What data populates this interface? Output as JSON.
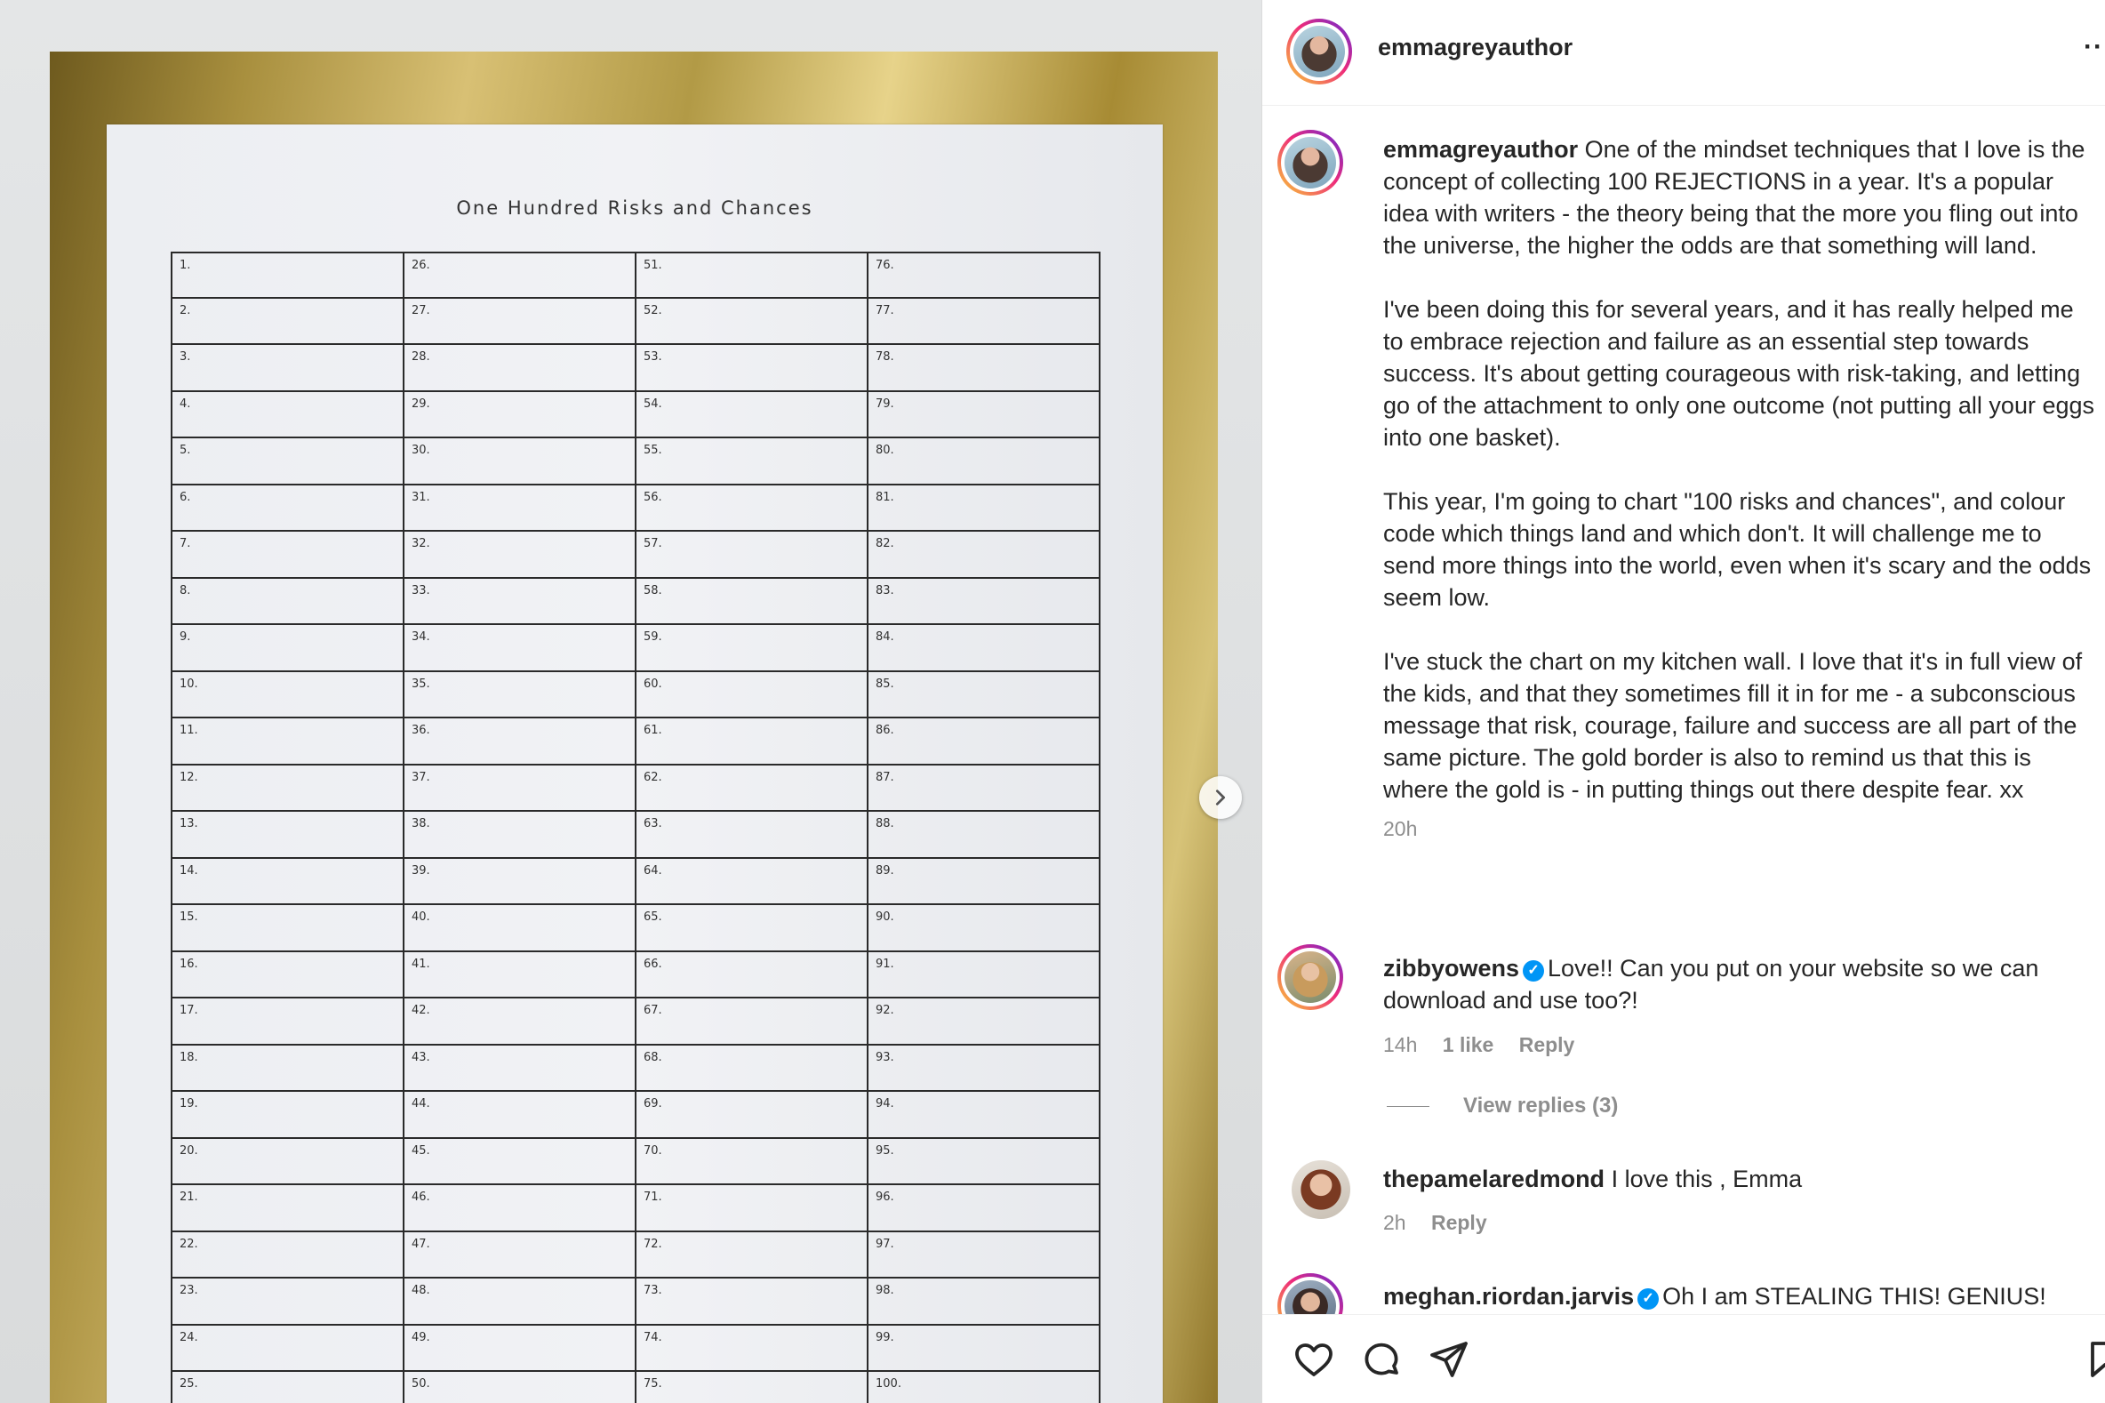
{
  "photo": {
    "chart_title": "One Hundred Risks and Chances",
    "columns": [
      [
        "1.",
        "2.",
        "3.",
        "4.",
        "5.",
        "6.",
        "7.",
        "8.",
        "9.",
        "10.",
        "11.",
        "12.",
        "13.",
        "14.",
        "15.",
        "16.",
        "17.",
        "18.",
        "19.",
        "20.",
        "21.",
        "22.",
        "23.",
        "24.",
        "25."
      ],
      [
        "26.",
        "27.",
        "28.",
        "29.",
        "30.",
        "31.",
        "32.",
        "33.",
        "34.",
        "35.",
        "36.",
        "37.",
        "38.",
        "39.",
        "40.",
        "41.",
        "42.",
        "43.",
        "44.",
        "45.",
        "46.",
        "47.",
        "48.",
        "49.",
        "50."
      ],
      [
        "51.",
        "52.",
        "53.",
        "54.",
        "55.",
        "56.",
        "57.",
        "58.",
        "59.",
        "60.",
        "61.",
        "62.",
        "63.",
        "64.",
        "65.",
        "66.",
        "67.",
        "68.",
        "69.",
        "70.",
        "71.",
        "72.",
        "73.",
        "74.",
        "75."
      ],
      [
        "76.",
        "77.",
        "78.",
        "79.",
        "80.",
        "81.",
        "82.",
        "83.",
        "84.",
        "85.",
        "86.",
        "87.",
        "88.",
        "89.",
        "90.",
        "91.",
        "92.",
        "93.",
        "94.",
        "95.",
        "96.",
        "97.",
        "98.",
        "99.",
        "100."
      ]
    ]
  },
  "post": {
    "author": "emmagreyauthor",
    "caption_paragraphs": [
      "One of the mindset techniques that I love is the concept of collecting 100 REJECTIONS in a year. It's a popular idea with writers - the theory being that the more you fling out into the universe, the higher the odds are that something will land.",
      "I've been doing this for several years, and it has really helped me to embrace rejection and failure as an essential step towards success. It's about getting courageous with risk-taking, and letting go of the attachment to only one outcome (not putting all your eggs into one basket).",
      "This year, I'm going to chart \"100 risks and chances\", and colour code which things land and which don't. It will challenge me to send more things into the world, even when it's scary and the odds seem low.",
      "I've stuck the chart on my kitchen wall. I love that it's in full view of the kids, and that they sometimes fill it in for me - a subconscious message that risk, courage, failure and success are all part of the same picture. The gold border is also to remind us that this is where the gold is - in putting things out there despite fear. xx"
    ],
    "caption_time": "20h"
  },
  "comments": [
    {
      "user": "zibbyowens",
      "verified": true,
      "text": "Love!! Can you put on your website so we can download and use too?!",
      "time": "14h",
      "likes": "1 like",
      "reply": "Reply",
      "view_replies": "View replies (3)"
    },
    {
      "user": "thepamelaredmond",
      "verified": false,
      "text": "I love this , Emma",
      "time": "2h",
      "reply": "Reply"
    },
    {
      "user": "meghan.riordan.jarvis",
      "verified": true,
      "text": "Oh I am STEALING THIS! GENIUS!"
    }
  ],
  "icons": {
    "verified": "check-badge",
    "like": "heart-icon",
    "comment": "comment-icon",
    "share": "send-icon",
    "save": "bookmark-icon",
    "more": "more-horizontal-icon",
    "next": "chevron-right-icon"
  },
  "colors": {
    "link": "#0095f6",
    "muted": "#8e8e8e",
    "text": "#262626"
  }
}
